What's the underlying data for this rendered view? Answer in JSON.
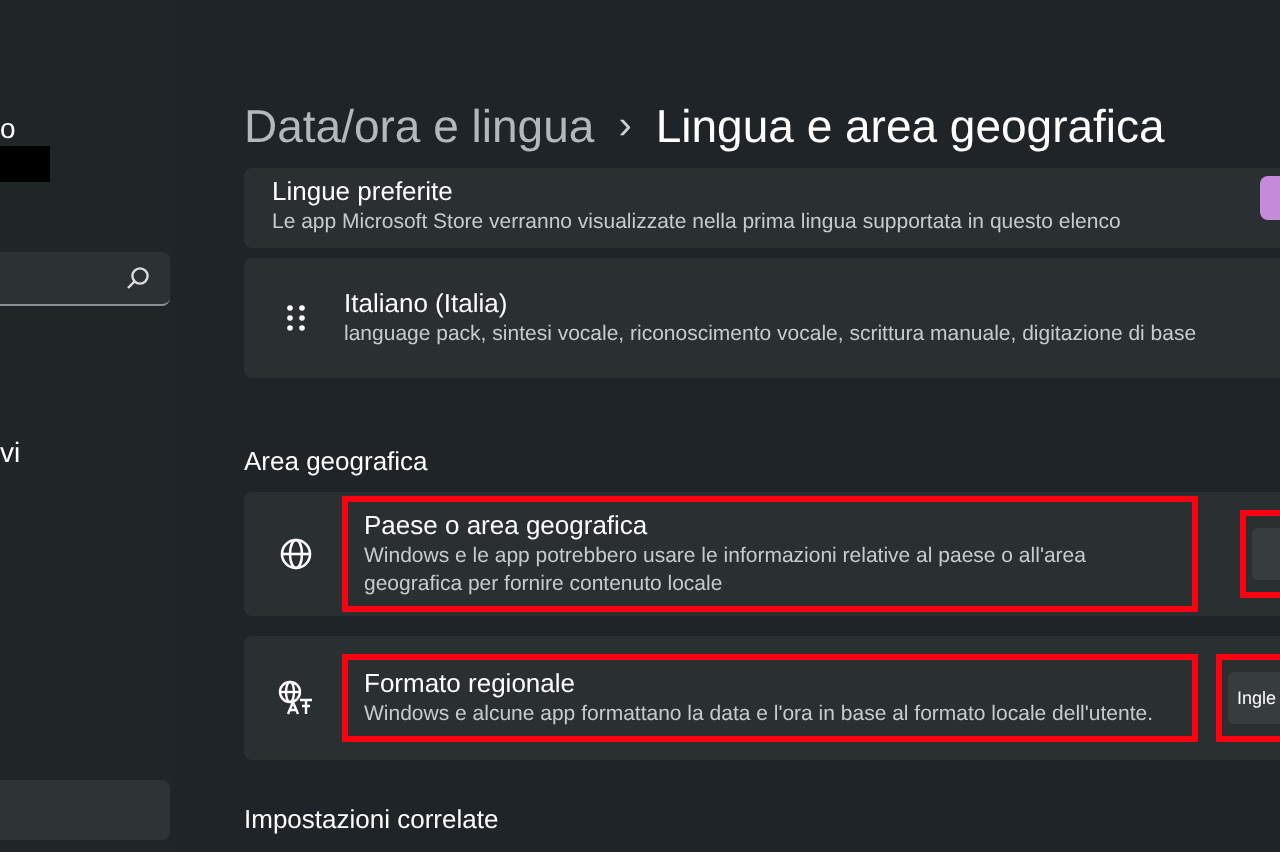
{
  "sidebar": {
    "account_text": "o",
    "items": [
      {
        "label": "vi",
        "selected": false
      },
      {
        "selected": true
      }
    ]
  },
  "breadcrumb": {
    "parent": "Data/ora e lingua",
    "separator": "›",
    "current": "Lingua e area geografica"
  },
  "preferred_languages": {
    "title": "Lingue preferite",
    "description": "Le app Microsoft Store verranno visualizzate nella prima lingua supportata in questo elenco"
  },
  "languages": [
    {
      "name": "Italiano (Italia)",
      "features": "language pack, sintesi vocale, riconoscimento vocale, scrittura manuale, digitazione di base"
    }
  ],
  "region": {
    "heading": "Area geografica",
    "settings": [
      {
        "kind": "country",
        "title": "Paese o area geografica",
        "description": "Windows e le app potrebbero usare le informazioni relative al paese o all'area geografica per fornire contenuto locale",
        "highlighted": true,
        "control_highlighted": true
      },
      {
        "kind": "format",
        "title": "Formato regionale",
        "description": "Windows e alcune app formattano la data e l'ora in base al formato locale dell'utente.",
        "highlighted": true,
        "control_highlighted": true,
        "value": "Ingle"
      }
    ]
  },
  "related": {
    "heading": "Impostazioni correlate"
  }
}
